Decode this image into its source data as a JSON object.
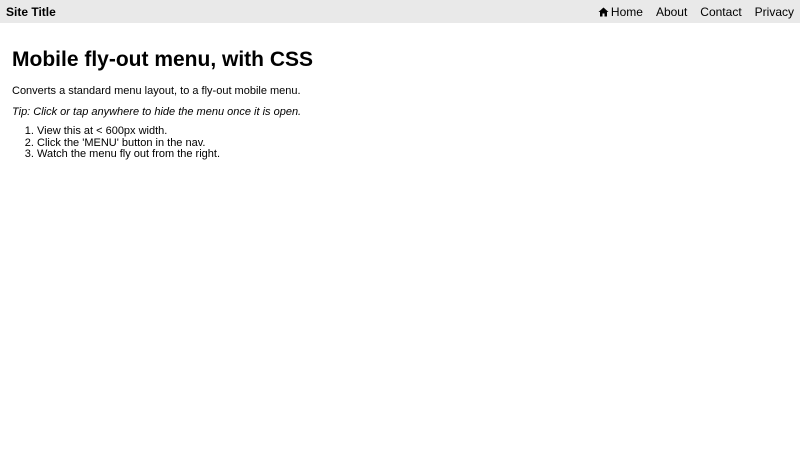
{
  "header": {
    "site_title": "Site Title",
    "nav": {
      "home": "Home",
      "home_icon": "home-icon",
      "about": "About",
      "contact": "Contact",
      "privacy": "Privacy"
    }
  },
  "main": {
    "title": "Mobile fly-out menu, with CSS",
    "description": "Converts a standard menu layout, to a fly-out mobile menu.",
    "tip": "Tip: Click or tap anywhere to hide the menu once it is open.",
    "steps": [
      "View this at < 600px width.",
      "Click the 'MENU' button in the nav.",
      "Watch the menu fly out from the right."
    ]
  }
}
